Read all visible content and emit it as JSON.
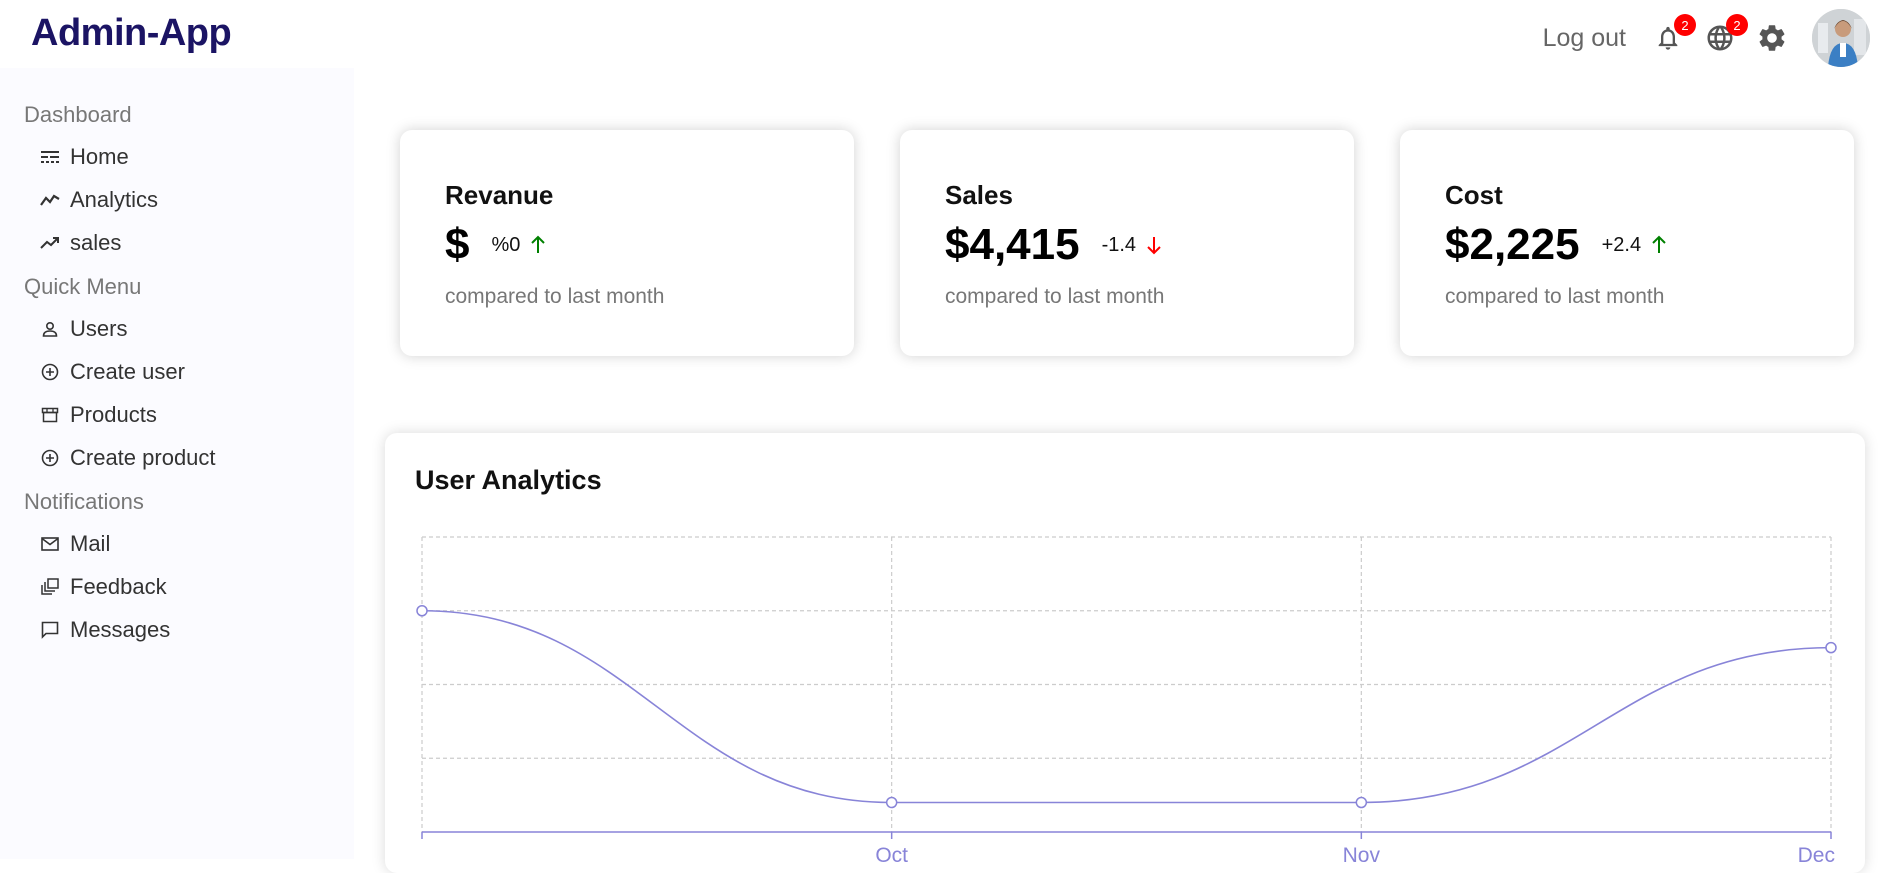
{
  "app": {
    "title": "Admin-App"
  },
  "topbar": {
    "logout_label": "Log out",
    "notifications_badge": "2",
    "language_badge": "2",
    "icons": [
      "bell-icon",
      "globe-icon",
      "gear-icon"
    ]
  },
  "sidebar": {
    "sections": [
      {
        "title": "Dashboard",
        "items": [
          {
            "label": "Home",
            "icon": "line-style-icon"
          },
          {
            "label": "Analytics",
            "icon": "timeline-icon"
          },
          {
            "label": "sales",
            "icon": "trending-up-icon"
          }
        ]
      },
      {
        "title": "Quick Menu",
        "items": [
          {
            "label": "Users",
            "icon": "person-icon"
          },
          {
            "label": "Create user",
            "icon": "add-circle-icon"
          },
          {
            "label": "Products",
            "icon": "store-icon"
          },
          {
            "label": "Create product",
            "icon": "add-circle-icon"
          }
        ]
      },
      {
        "title": "Notifications",
        "items": [
          {
            "label": "Mail",
            "icon": "mail-icon"
          },
          {
            "label": "Feedback",
            "icon": "dynamic-feed-icon"
          },
          {
            "label": "Messages",
            "icon": "chat-bubble-icon"
          }
        ]
      }
    ]
  },
  "cards": [
    {
      "title": "Revanue",
      "money": "$",
      "rate": "%0",
      "trend": "up",
      "subtitle": "compared to last month"
    },
    {
      "title": "Sales",
      "money": "$4,415",
      "rate": "-1.4",
      "trend": "down",
      "subtitle": "compared to last month"
    },
    {
      "title": "Cost",
      "money": "$2,225",
      "rate": "+2.4",
      "trend": "up",
      "subtitle": "compared to last month"
    }
  ],
  "colors": {
    "brand": "#1b1464",
    "line": "#8884d8",
    "up": "#008000",
    "down": "#ff0000",
    "badge": "#ff0000"
  },
  "chart_data": {
    "type": "line",
    "title": "User Analytics",
    "x": [
      "",
      "Oct",
      "Nov",
      "Dec"
    ],
    "series": [
      {
        "values": [
          3000,
          400,
          400,
          2500
        ]
      }
    ],
    "ylim": [
      0,
      4000
    ],
    "grid": true
  }
}
